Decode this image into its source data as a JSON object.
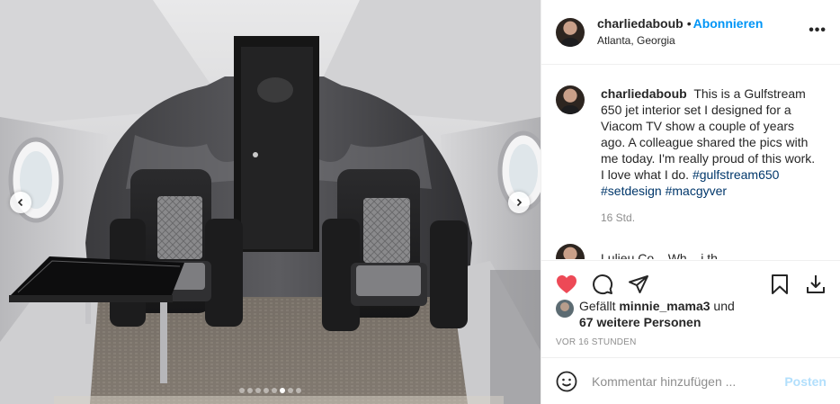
{
  "header": {
    "username": "charliedaboub",
    "separator": "•",
    "follow_label": "Abonnieren",
    "location": "Atlanta, Georgia",
    "more_label": "•••"
  },
  "caption": {
    "username": "charliedaboub",
    "text": "This is a Gulfstream 650 jet interior set I designed for a Viacom TV show a couple of years ago. A colleague shared the pics with me today. I'm really proud of this work. I love what I do.",
    "hashtags": [
      "#gulfstream650",
      "#setdesign",
      "#macgyver"
    ],
    "time": "16 Std."
  },
  "next_comment": {
    "text": "Lulieu Co... Wh... i th..."
  },
  "likes": {
    "prefix": "Gefällt",
    "first_user": "minnie_mama3",
    "joiner": "und",
    "others": "67 weitere Personen"
  },
  "posted": "VOR 16 STUNDEN",
  "comment_box": {
    "placeholder": "Kommentar hinzufügen ...",
    "post_label": "Posten"
  },
  "carousel": {
    "total": 8,
    "active_index": 5
  },
  "icons": [
    "chevron-left-icon",
    "chevron-right-icon",
    "more-icon",
    "heart-icon",
    "comment-icon",
    "share-icon",
    "bookmark-icon",
    "download-icon",
    "emoji-icon"
  ],
  "colors": {
    "accent": "#0095f6",
    "like_red": "#ed4956",
    "hashtag": "#00376b",
    "muted": "#8e8e8e",
    "post_disabled": "#b2dffc"
  }
}
